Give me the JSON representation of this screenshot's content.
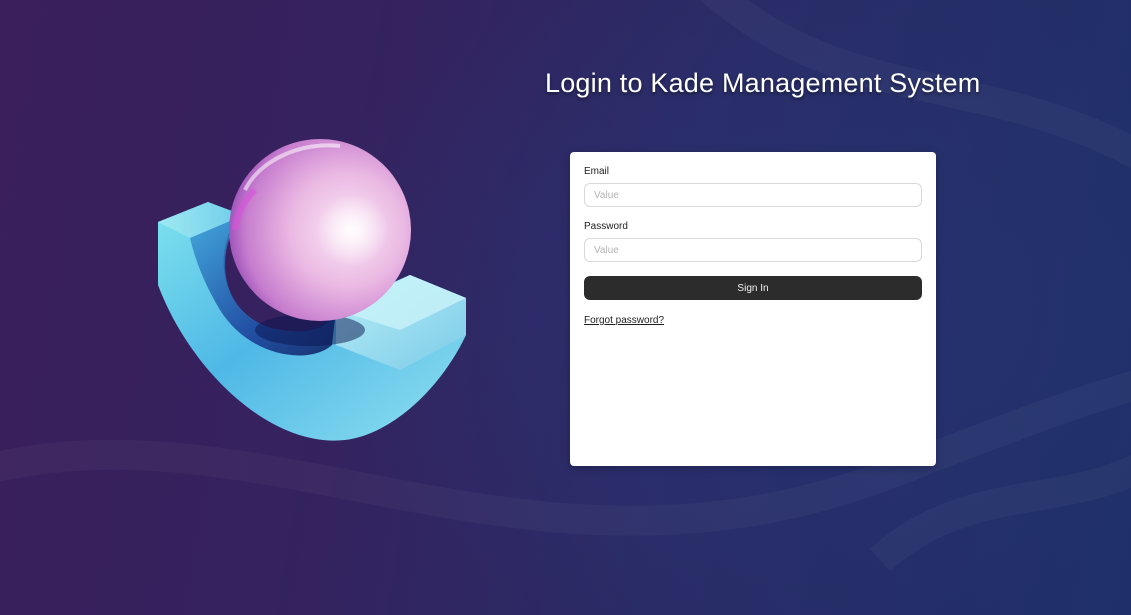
{
  "page": {
    "title": "Login to Kade Management System"
  },
  "hero": {
    "illustration": "3d-sphere-in-cradle"
  },
  "login_form": {
    "email_label": "Email",
    "email_placeholder": "Value",
    "email_value": "",
    "password_label": "Password",
    "password_placeholder": "Value",
    "password_value": "",
    "submit_label": "Sign In",
    "forgot_label": "Forgot password?"
  },
  "colors": {
    "background_start": "#3a1f5c",
    "background_end": "#1f3068",
    "button": "#2c2c2c",
    "card": "#ffffff"
  }
}
